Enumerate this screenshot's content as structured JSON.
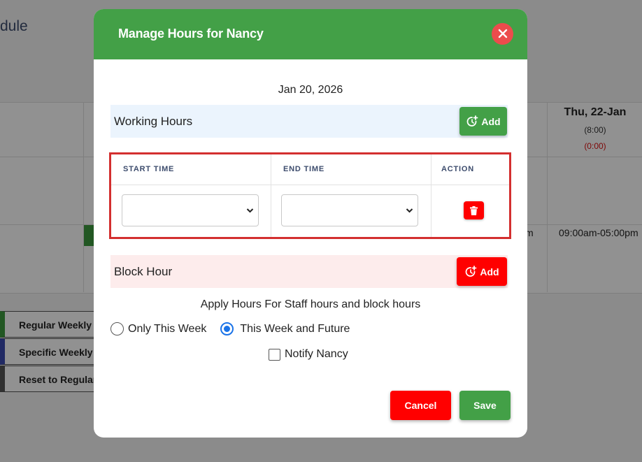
{
  "background": {
    "page_title_fragment": "dule",
    "day_header": {
      "label": "Thu, 22-Jan",
      "hours": "(8:00)",
      "block": "(0:00)"
    },
    "cell_fragment": "m",
    "cell_hours": "09:00am-05:00pm",
    "side_buttons": [
      "Regular Weekly H",
      "Specific Weekly",
      "Reset to Regular"
    ]
  },
  "modal": {
    "title": "Manage Hours for Nancy",
    "close_icon": "close-icon",
    "date": "Jan 20, 2026",
    "working_hours": {
      "label": "Working Hours",
      "add_label": "Add",
      "icon": "clock-plus-icon"
    },
    "table": {
      "columns": [
        "START TIME",
        "END TIME",
        "ACTION"
      ],
      "rows": [
        {
          "start": "",
          "end": "",
          "action_icon": "trash-icon"
        }
      ]
    },
    "block_hour": {
      "label": "Block Hour",
      "add_label": "Add",
      "icon": "clock-plus-icon"
    },
    "apply_label": "Apply Hours For Staff hours and block hours",
    "apply_options": [
      {
        "label": "Only This Week",
        "checked": false
      },
      {
        "label": "This Week and Future",
        "checked": true
      }
    ],
    "notify": {
      "label": "Notify Nancy",
      "checked": false
    },
    "cancel_label": "Cancel",
    "save_label": "Save"
  },
  "colors": {
    "header_green": "#43a047",
    "danger_red": "#ff0000",
    "highlight_border": "#d32f2f",
    "radio_blue": "#1a73e8"
  }
}
